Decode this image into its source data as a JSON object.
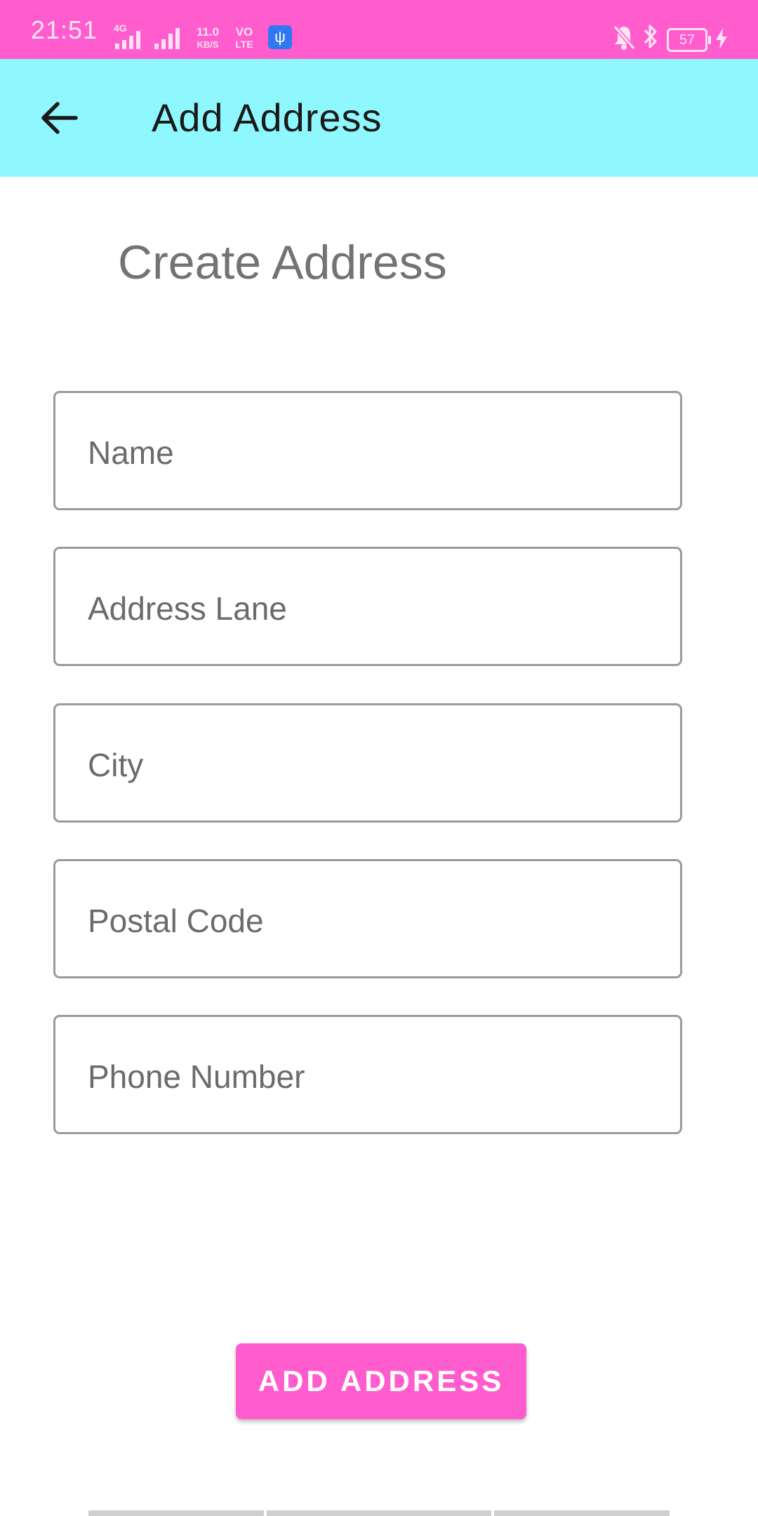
{
  "status_bar": {
    "time": "21:51",
    "network_type": "4G",
    "data_speed_value": "11.0",
    "data_speed_unit": "KB/S",
    "volte_top": "VO",
    "volte_bottom": "LTE",
    "battery_level": "57",
    "icons": [
      "signal-icon",
      "signal-icon",
      "usb-icon",
      "mute-icon",
      "bluetooth-icon",
      "battery-icon",
      "charging-icon"
    ],
    "background_color": "#ff5ccd"
  },
  "app_bar": {
    "title": "Add Address",
    "background_color": "#8ff8fe",
    "back_icon": "arrow-left-icon"
  },
  "form": {
    "heading": "Create Address",
    "fields": [
      {
        "placeholder": "Name",
        "value": ""
      },
      {
        "placeholder": "Address Lane",
        "value": ""
      },
      {
        "placeholder": "City",
        "value": ""
      },
      {
        "placeholder": "Postal Code",
        "value": ""
      },
      {
        "placeholder": "Phone Number",
        "value": ""
      }
    ],
    "submit_label": "ADD ADDRESS",
    "accent_color": "#ff5ccd"
  }
}
